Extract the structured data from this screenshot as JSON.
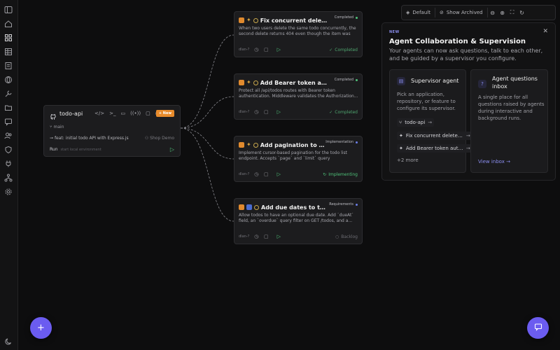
{
  "sidebar": {
    "icons": [
      "sidebar-toggle-icon",
      "home-icon",
      "grid-icon",
      "table-icon",
      "list-icon",
      "globe-icon",
      "wrench-icon",
      "folder-icon",
      "users-icon",
      "shield-icon",
      "plug-icon",
      "flow-icon",
      "gear-icon",
      "moon-icon"
    ]
  },
  "toolbar": {
    "default_label": "Default",
    "archived_label": "Show Archived"
  },
  "repo": {
    "name": "todo-api",
    "new_label": "+ New",
    "branch": "main",
    "commit": "feat: initial todo API with Express.js",
    "shop": "Shop Demo",
    "run_label": "Run",
    "run_sub": "start local environment"
  },
  "tasks": [
    {
      "title": "Fix concurrent delete r...",
      "status": "Completed",
      "desc": "When two users delete the same todo concurrently, the second delete returns 404 even though the item was visi...",
      "id": "dlan-?",
      "state": "Completed"
    },
    {
      "title": "Add Bearer token auth ...",
      "status": "Completed",
      "desc": "Protect all /api/todos routes with Bearer token authentication. Middleware validates the Authorization...",
      "id": "dlan-?",
      "state": "Completed"
    },
    {
      "title": "Add pagination to GET /...",
      "status": "Implementation",
      "desc": "Implement cursor-based pagination for the todo list endpoint. Accepts `page` and `limit` query parameters,...",
      "id": "dlan-?",
      "state": "Implementing"
    },
    {
      "title": "Add due dates to todos",
      "status": "Requirements",
      "desc": "Allow todos to have an optional due date. Add `dueAt` field, an `overdue` query filter on GET /todos, and a...",
      "id": "dlan-?",
      "state": "Backlog"
    }
  ],
  "panel": {
    "badge": "NEW",
    "title": "Agent Collaboration & Supervision",
    "subtitle": "Your agents can now ask questions, talk to each other, and be guided by a supervisor you configure.",
    "supervisor": {
      "title": "Supervisor agent",
      "desc": "Pick an application, repository, or feature to configure its supervisor.",
      "chips": [
        "todo-api",
        "Fix concurrent delete ra...",
        "Add Bearer token auth ..."
      ],
      "more": "+2 more"
    },
    "inbox": {
      "title": "Agent questions inbox",
      "desc": "A single place for all questions raised by agents during interactive and background runs.",
      "link": "View inbox →"
    }
  },
  "colors": {
    "accent": "#6b5cf0",
    "new_button": "#e88b2b",
    "success": "#4fc37a"
  }
}
